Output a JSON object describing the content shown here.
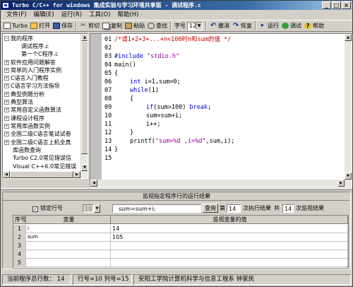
{
  "window": {
    "title": "Turbo C/C++ for windows 集成实验与学习环境共享版 - 调试程序.c",
    "minimize": "_",
    "maximize": "□",
    "close": "×"
  },
  "menu": [
    "文件(F)",
    "编辑(E)",
    "运行(R)",
    "工具(O)",
    "帮助(H)"
  ],
  "toolbar": {
    "new": "Turbo",
    "open": "打开",
    "save": "保存",
    "cut": "剪切",
    "copy": "复制",
    "paste": "粘贴",
    "find": "查找",
    "fontsize_label": "字号",
    "fontsize_value": "12",
    "undo": "撤消",
    "redo": "恢复",
    "run": "运行",
    "debug": "调试",
    "help": "帮助"
  },
  "tree": [
    {
      "toggle": "−",
      "label": "我的程序"
    },
    {
      "toggle": "",
      "label": "调试程序.c"
    },
    {
      "toggle": "",
      "label": "第一个C程序.c"
    },
    {
      "toggle": "+",
      "label": "软件应用问题解答"
    },
    {
      "toggle": "+",
      "label": "简单的入门程序实例"
    },
    {
      "toggle": "+",
      "label": "C语言入门教程"
    },
    {
      "toggle": "+",
      "label": "C语言学习方法指导"
    },
    {
      "toggle": "+",
      "label": "典型例题分析"
    },
    {
      "toggle": "+",
      "label": "典型算法"
    },
    {
      "toggle": "+",
      "label": "常用自定义函数算法"
    },
    {
      "toggle": "+",
      "label": "课程设计程序"
    },
    {
      "toggle": "+",
      "label": "常用库函数实例"
    },
    {
      "toggle": "+",
      "label": "全国二级C语言笔试试卷"
    },
    {
      "toggle": "+",
      "label": "全国二级C语言上机全真"
    },
    {
      "toggle": "",
      "label": "库函数查询"
    },
    {
      "toggle": "",
      "label": "Turbo C2.0常见错误信"
    },
    {
      "toggle": "",
      "label": "Visual C++6.0常见错误"
    }
  ],
  "code": {
    "line_numbers": [
      "01",
      "02",
      "03",
      "04",
      "05",
      "06",
      "07",
      "08",
      "09",
      "10",
      "11",
      "12",
      "13",
      "14",
      "15"
    ],
    "l01": "/*请1+2+3+...+n<100时n和sum的值 */",
    "l03_kw": "#include ",
    "l03_str": "\"stdio.h\"",
    "l04": "main()",
    "l05": "{",
    "l06_kw": "int",
    "l06_rest": " i=1,sum=0;",
    "l07_kw": "while",
    "l07_rest": "(1)",
    "l08": "{",
    "l09_kw": "if",
    "l09_mid": "(sum>100) ",
    "l09_kw2": "break",
    "l09_end": ";",
    "l10": "sum=sum+i;",
    "l11": "i++;",
    "l12": "}",
    "l13_pre": "printf(",
    "l13_str": "\"sum=%d ,i=%d\"",
    "l13_post": ",sum,i);",
    "l14": "}"
  },
  "watch": {
    "title": "监视指定程序行的运行结果",
    "lock_label": "锁定行号",
    "lock_checked": "✓",
    "line_value": "10",
    "line_code": "sum=sum+i;",
    "query_button": "查询",
    "nth_label": "第",
    "nth_value": "14",
    "nth_suffix": "次执行结果",
    "total_label": "共",
    "total_value": "14",
    "total_suffix": "次监视结果",
    "headers": {
      "no": "序号",
      "var": "变量",
      "val": "监视变量的值"
    },
    "rows": [
      {
        "no": "1",
        "var": "i",
        "val": "14"
      },
      {
        "no": "2",
        "var": "sum",
        "val": "105"
      },
      {
        "no": "3",
        "var": "",
        "val": ""
      },
      {
        "no": "4",
        "var": "",
        "val": ""
      },
      {
        "no": "5",
        "var": "",
        "val": ""
      }
    ]
  },
  "status": {
    "total_lines": "当前程序总行数： 14",
    "position": "行号=10  列号=15",
    "author": "安阳工学院计算机科学与信息工程系  钟家民"
  }
}
